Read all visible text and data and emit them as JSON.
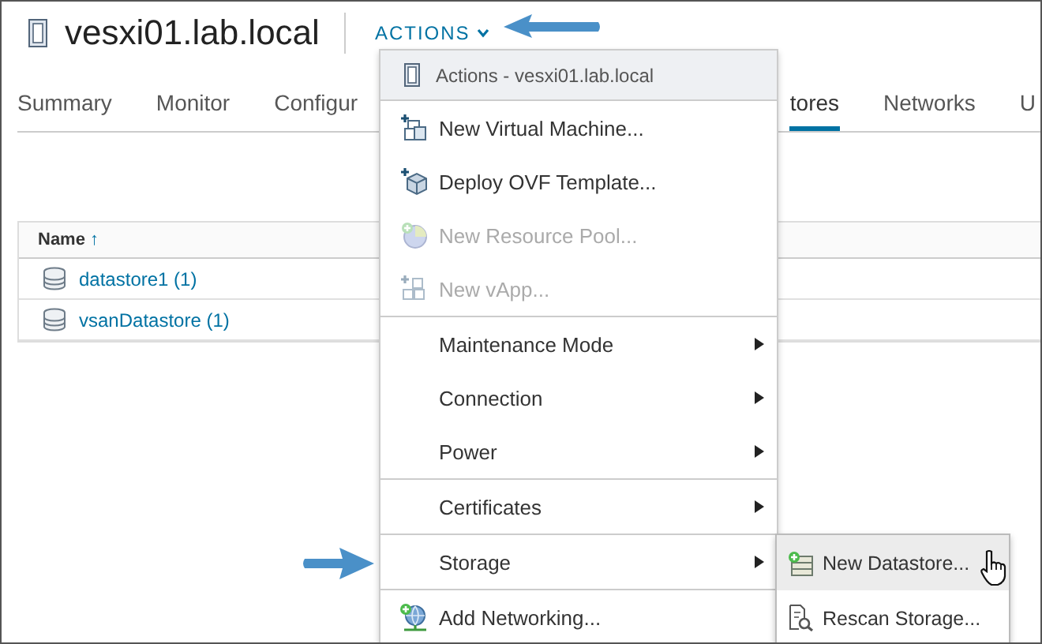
{
  "header": {
    "title": "vesxi01.lab.local",
    "actions_label": "ACTIONS"
  },
  "tabs": [
    {
      "label": "Summary",
      "selected": false
    },
    {
      "label": "Monitor",
      "selected": false
    },
    {
      "label": "Configur",
      "selected": false
    },
    {
      "label": "tores",
      "selected": true
    },
    {
      "label": "Networks",
      "selected": false
    },
    {
      "label": "U",
      "selected": false
    }
  ],
  "table": {
    "columns": [
      {
        "label": "Name",
        "sort_indicator": "↑"
      }
    ],
    "rows": [
      {
        "name": "datastore1 (1)"
      },
      {
        "name": "vsanDatastore (1)"
      }
    ]
  },
  "menu": {
    "header": "Actions - vesxi01.lab.local",
    "sections": [
      [
        {
          "kind": "action",
          "label": "New Virtual Machine...",
          "disabled": false
        },
        {
          "kind": "action",
          "label": "Deploy OVF Template...",
          "disabled": false
        },
        {
          "kind": "action",
          "label": "New Resource Pool...",
          "disabled": true
        },
        {
          "kind": "action",
          "label": "New vApp...",
          "disabled": true
        }
      ],
      [
        {
          "kind": "submenu",
          "label": "Maintenance Mode",
          "expanded": false
        },
        {
          "kind": "submenu",
          "label": "Connection",
          "expanded": false
        },
        {
          "kind": "submenu",
          "label": "Power",
          "expanded": false
        }
      ],
      [
        {
          "kind": "submenu",
          "label": "Certificates",
          "expanded": false
        }
      ],
      [
        {
          "kind": "submenu",
          "label": "Storage",
          "expanded": true,
          "children": [
            {
              "label": "New Datastore...",
              "selected": true
            },
            {
              "label": "Rescan Storage...",
              "selected": false
            }
          ]
        }
      ],
      [
        {
          "kind": "action",
          "label": "Add Networking...",
          "disabled": false
        }
      ]
    ]
  }
}
